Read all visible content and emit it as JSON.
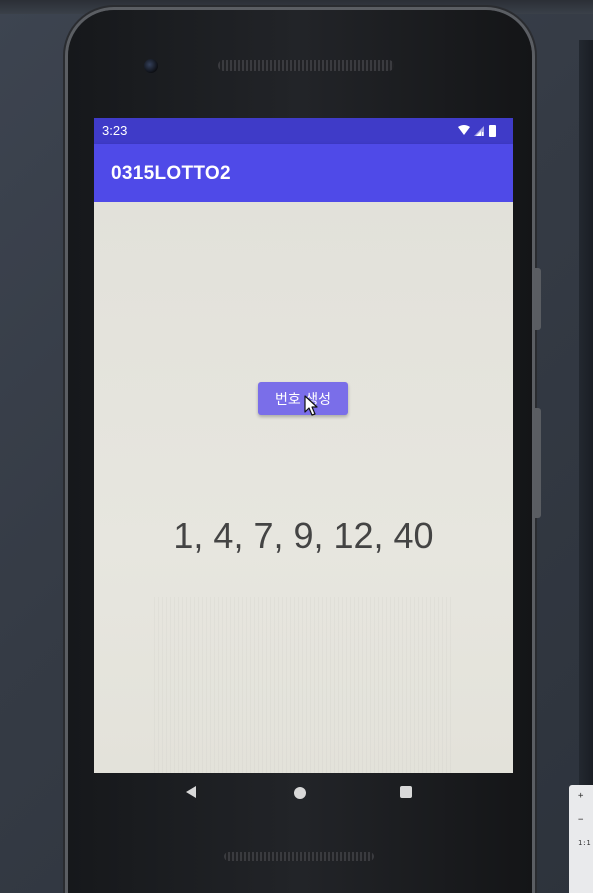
{
  "status_bar": {
    "time": "3:23",
    "icons": [
      "wifi-icon",
      "cellular-signal-icon",
      "battery-icon"
    ]
  },
  "app_bar": {
    "title": "0315LOTTO2"
  },
  "main": {
    "generate_button_label": "번호 생성",
    "result_numbers": "1, 4, 7, 9, 12, 40"
  },
  "nav_bar": {
    "icons": [
      "back-icon",
      "home-icon",
      "recents-icon"
    ]
  },
  "side_panel": {
    "label_plus": "+",
    "label_minus": "−",
    "label_ratio": "1:1"
  },
  "colors": {
    "status_bar": "#3f3bc8",
    "app_bar": "#4f4ae8",
    "button": "#7a6ee9",
    "screen_background": "#e6e5de",
    "result_text": "#444444"
  }
}
